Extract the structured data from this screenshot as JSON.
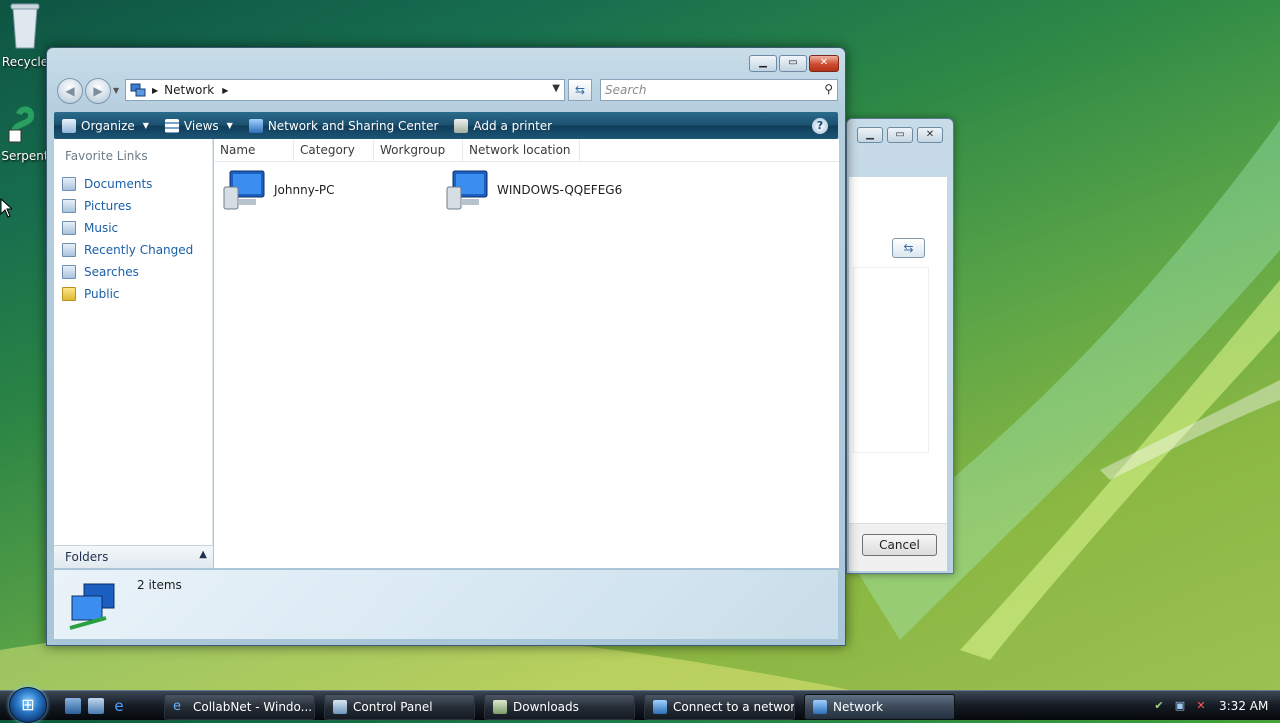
{
  "desktop": {
    "icons": [
      {
        "label": "Recycle"
      },
      {
        "label": "Serpent"
      }
    ]
  },
  "window": {
    "address": {
      "segment": "Network"
    },
    "search_placeholder": "Search",
    "command_bar": {
      "organize": "Organize",
      "views": "Views",
      "network_sharing": "Network and Sharing Center",
      "add_printer": "Add a printer",
      "help": "?"
    },
    "favorites": {
      "header": "Favorite Links",
      "items": [
        {
          "label": "Documents"
        },
        {
          "label": "Pictures"
        },
        {
          "label": "Music"
        },
        {
          "label": "Recently Changed"
        },
        {
          "label": "Searches"
        },
        {
          "label": "Public"
        }
      ],
      "folders": "Folders"
    },
    "columns": [
      "Name",
      "Category",
      "Workgroup",
      "Network location"
    ],
    "items": [
      {
        "name": "Johnny-PC"
      },
      {
        "name": "WINDOWS-QQEFEG6"
      }
    ],
    "details": {
      "count": "2 items"
    }
  },
  "background_dialog": {
    "cancel": "Cancel"
  },
  "taskbar": {
    "tasks": [
      {
        "label": "CollabNet - Windo..."
      },
      {
        "label": "Control Panel"
      },
      {
        "label": "Downloads"
      },
      {
        "label": "Connect to a network"
      },
      {
        "label": "Network"
      }
    ],
    "clock": "3:32 AM"
  },
  "colors": {
    "accent": "#1a5fa8",
    "command_bar": "#1b4f6e"
  }
}
